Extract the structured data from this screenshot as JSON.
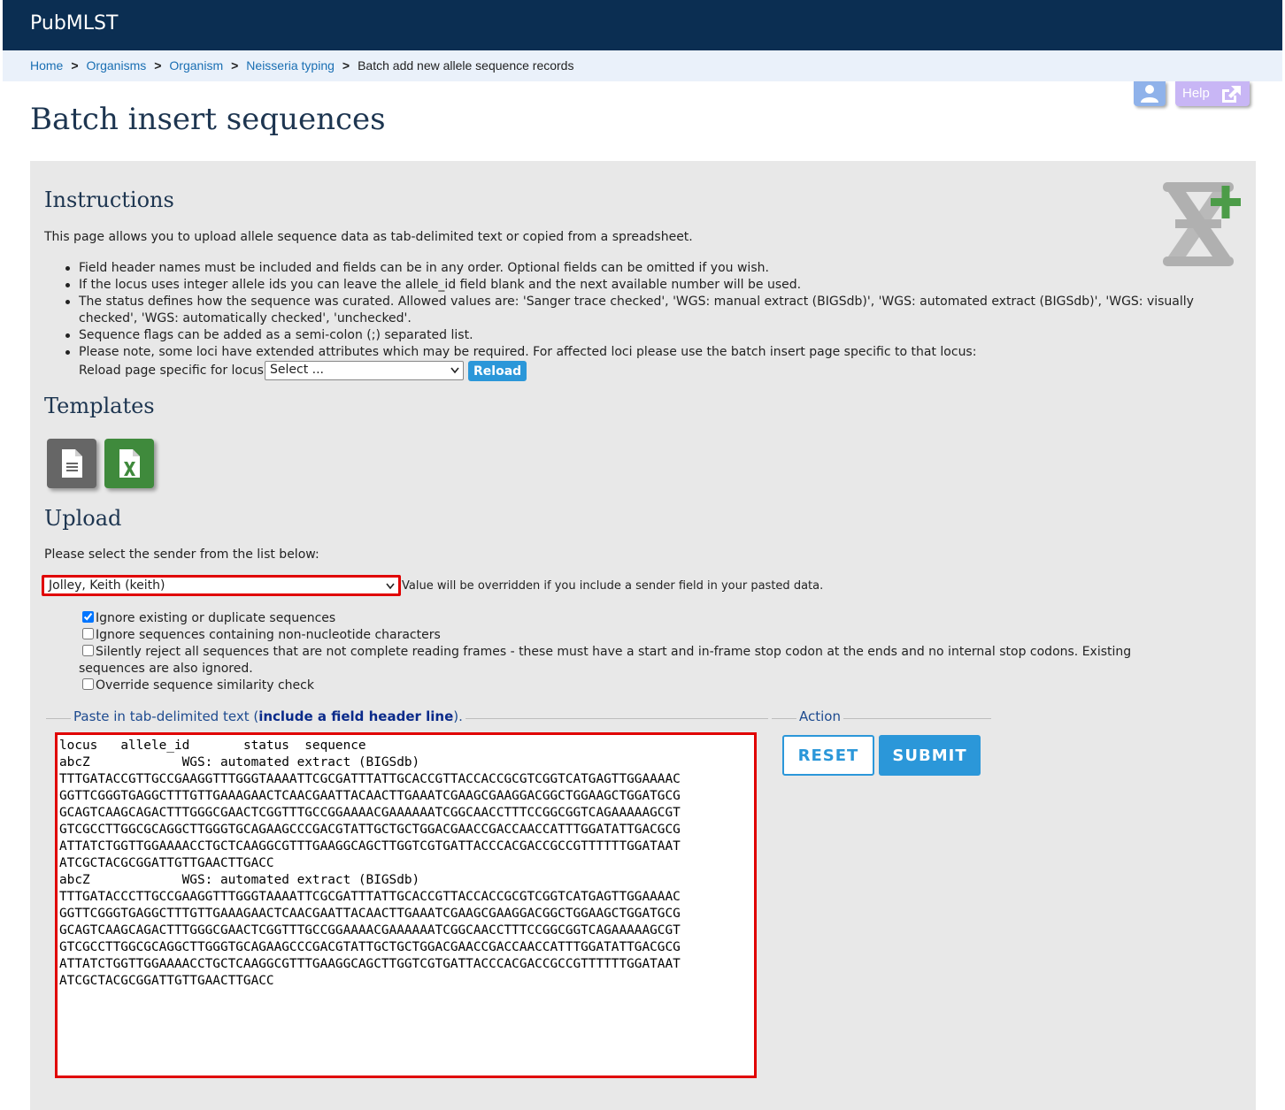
{
  "header": {
    "brand": "PubMLST"
  },
  "breadcrumb": {
    "items": [
      "Home",
      "Organisms",
      "Organism",
      "Neisseria typing"
    ],
    "separator": ">",
    "current": "Batch add new allele sequence records"
  },
  "toolbar": {
    "help_label": "Help"
  },
  "page": {
    "title": "Batch insert sequences"
  },
  "instructions": {
    "heading": "Instructions",
    "intro": "This page allows you to upload allele sequence data as tab-delimited text or copied from a spreadsheet.",
    "items": [
      "Field header names must be included and fields can be in any order. Optional fields can be omitted if you wish.",
      "If the locus uses integer allele ids you can leave the allele_id field blank and the next available number will be used.",
      "The status defines how the sequence was curated. Allowed values are: 'Sanger trace checked', 'WGS: manual extract (BIGSdb)', 'WGS: automated extract (BIGSdb)', 'WGS: visually checked', 'WGS: automatically checked', 'unchecked'.",
      "Sequence flags can be added as a semi-colon (;) separated list.",
      "Please note, some loci have extended attributes which may be required. For affected loci please use the batch insert page specific to that locus:"
    ],
    "reload_label": "Reload page specific for locus:",
    "locus_select_value": "Select ...",
    "reload_button": "Reload"
  },
  "templates": {
    "heading": "Templates"
  },
  "upload": {
    "heading": "Upload",
    "sender_prompt": "Please select the sender from the list below:",
    "sender_value": "Jolley, Keith (keith)",
    "sender_note": "Value will be overridden if you include a sender field in your pasted data.",
    "options": [
      {
        "label": "Ignore existing or duplicate sequences",
        "checked": true
      },
      {
        "label": "Ignore sequences containing non-nucleotide characters",
        "checked": false
      },
      {
        "label": "Silently reject all sequences that are not complete reading frames - these must have a start and in-frame stop codon at the ends and no internal stop codons. Existing sequences are also ignored.",
        "checked": false
      },
      {
        "label": "Override sequence similarity check",
        "checked": false
      }
    ],
    "paste_legend_prefix": "Paste in tab-delimited text (",
    "paste_legend_bold": "include a field header line",
    "paste_legend_suffix": ").",
    "pasted_text": "locus\tallele_id\tstatus\tsequence\nabcZ\t\tWGS: automated extract (BIGSdb)\nTTTGATACCGTTGCCGAAGGTTTGGGTAAAATTCGCGATTTATTGCACCGTTACCACCGCGTCGGTCATGAGTTGGAAAAC\nGGTTCGGGTGAGGCTTTGTTGAAAGAACTCAACGAATTACAACTTGAAATCGAAGCGAAGGACGGCTGGAAGCTGGATGCG\nGCAGTCAAGCAGACTTTGGGCGAACTCGGTTTGCCGGAAAACGAAAAAATCGGCAACCTTTCCGGCGGTCAGAAAAAGCGT\nGTCGCCTTGGCGCAGGCTTGGGTGCAGAAGCCCGACGTATTGCTGCTGGACGAACCGACCAACCATTTGGATATTGACGCG\nATTATCTGGTTGGAAAACCTGCTCAAGGCGTTTGAAGGCAGCTTGGTCGTGATTACCCACGACCGCCGTTTTTTGGATAAT\nATCGCTACGCGGATTGTTGAACTTGACC\nabcZ\t\tWGS: automated extract (BIGSdb)\nTTTGATACCCTTGCCGAAGGTTTGGGTAAAATTCGCGATTTATTGCACCGTTACCACCGCGTCGGTCATGAGTTGGAAAAC\nGGTTCGGGTGAGGCTTTGTTGAAAGAACTCAACGAATTACAACTTGAAATCGAAGCGAAGGACGGCTGGAAGCTGGATGCG\nGCAGTCAAGCAGACTTTGGGCGAACTCGGTTTGCCGGAAAACGAAAAAATCGGCAACCTTTCCGGCGGTCAGAAAAAGCGT\nGTCGCCTTGGCGCAGGCTTGGGTGCAGAAGCCCGACGTATTGCTGCTGGACGAACCGACCAACCATTTGGATATTGACGCG\nATTATCTGGTTGGAAAACCTGCTCAAGGCGTTTGAAGGCAGCTTGGTCGTGATTACCCACGACCGCCGTTTTTTGGATAAT\nATCGCTACGCGGATTGTTGAACTTGACC"
  },
  "action": {
    "legend": "Action",
    "reset_label": "RESET",
    "submit_label": "SUBMIT"
  },
  "colors": {
    "topbar": "#0b2e52",
    "breadcrumb_bg": "#eaf1fa",
    "panel_bg": "#e8e8e8",
    "accent": "#2b97d9",
    "highlight": "#e00000",
    "excel_green": "#3f8a3c"
  },
  "icons": {
    "user": "user-icon",
    "help": "external-link-icon",
    "dna_add": "dna-add-icon",
    "text_file": "text-file-icon",
    "excel": "excel-file-icon"
  }
}
